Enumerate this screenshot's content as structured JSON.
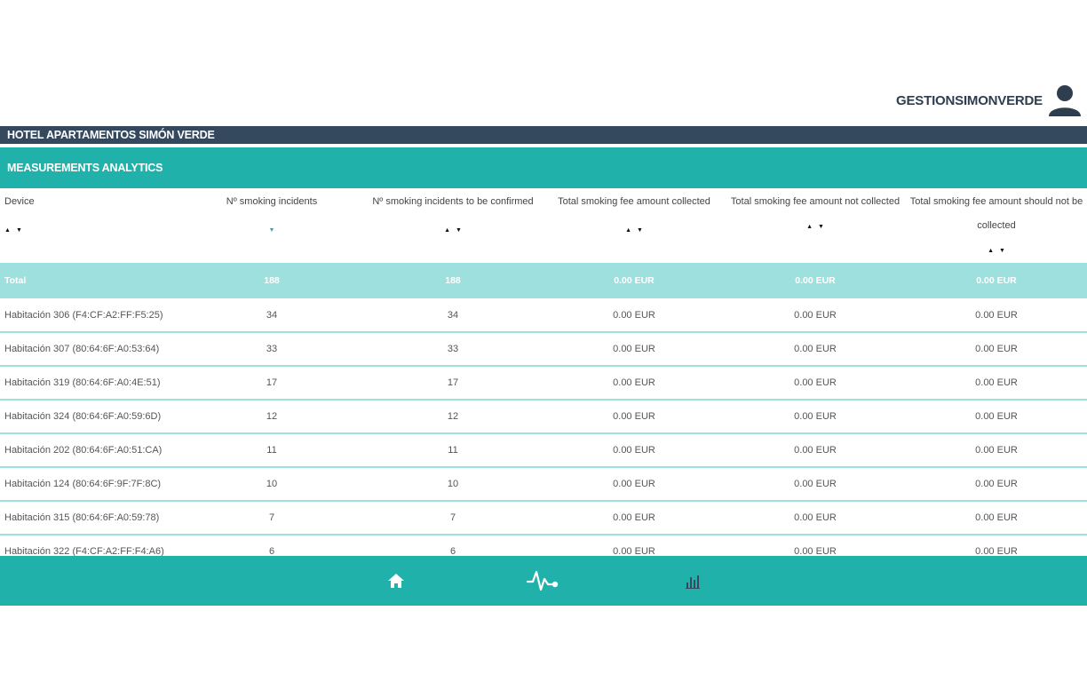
{
  "user": {
    "name": "GESTIONSIMONVERDE",
    "icon": "user-icon"
  },
  "hotel": {
    "name": "HOTEL APARTAMENTOS SIMÓN VERDE"
  },
  "section": {
    "title": "MEASUREMENTS ANALYTICS"
  },
  "table": {
    "headers": [
      "Device",
      "Nº smoking incidents",
      "Nº smoking incidents to be confirmed",
      "Total smoking fee amount collected",
      "Total smoking fee amount not collected",
      "Total smoking fee amount should not be collected"
    ],
    "total": [
      "Total",
      "188",
      "188",
      "0.00 EUR",
      "0.00 EUR",
      "0.00 EUR"
    ],
    "rows": [
      [
        "Habitación 306 (F4:CF:A2:FF:F5:25)",
        "34",
        "34",
        "0.00 EUR",
        "0.00 EUR",
        "0.00 EUR"
      ],
      [
        "Habitación 307 (80:64:6F:A0:53:64)",
        "33",
        "33",
        "0.00 EUR",
        "0.00 EUR",
        "0.00 EUR"
      ],
      [
        "Habitación 319 (80:64:6F:A0:4E:51)",
        "17",
        "17",
        "0.00 EUR",
        "0.00 EUR",
        "0.00 EUR"
      ],
      [
        "Habitación 324 (80:64:6F:A0:59:6D)",
        "12",
        "12",
        "0.00 EUR",
        "0.00 EUR",
        "0.00 EUR"
      ],
      [
        "Habitación 202 (80:64:6F:A0:51:CA)",
        "11",
        "11",
        "0.00 EUR",
        "0.00 EUR",
        "0.00 EUR"
      ],
      [
        "Habitación 124 (80:64:6F:9F:7F:8C)",
        "10",
        "10",
        "0.00 EUR",
        "0.00 EUR",
        "0.00 EUR"
      ],
      [
        "Habitación 315 (80:64:6F:A0:59:78)",
        "7",
        "7",
        "0.00 EUR",
        "0.00 EUR",
        "0.00 EUR"
      ],
      [
        "Habitación 322 (F4:CF:A2:FF:F4:A6)",
        "6",
        "6",
        "0.00 EUR",
        "0.00 EUR",
        "0.00 EUR"
      ]
    ]
  },
  "nav": {
    "items": [
      {
        "name": "home-icon"
      },
      {
        "name": "pulse-icon"
      },
      {
        "name": "bar-chart-icon"
      }
    ]
  },
  "colors": {
    "teal": "#20b2aa",
    "light_teal": "#9ee0dd",
    "dark": "#34495e"
  }
}
